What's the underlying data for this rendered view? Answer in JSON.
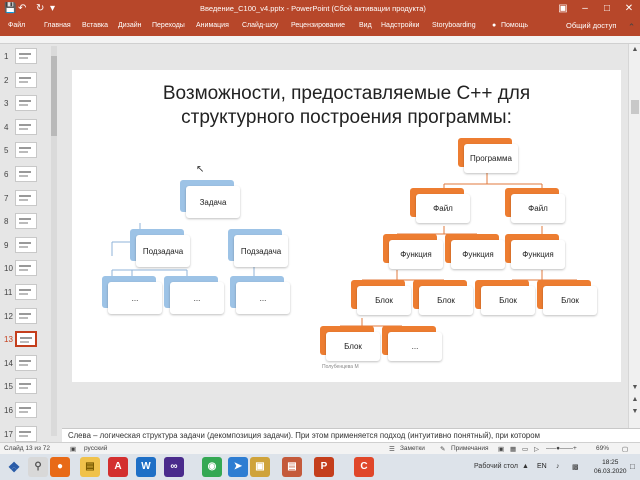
{
  "window": {
    "doc_title": "Введение_С100_v4.pptx - PowerPoint (Сбой активации продукта)",
    "save_icon": "save-icon",
    "undo_icon": "undo-icon",
    "redo_icon": "redo-icon",
    "minimize_icon": "minimize-icon",
    "restore_icon": "restore-icon",
    "close_icon": "close-icon"
  },
  "ribbon": {
    "tabs": [
      "Файл",
      "Главная",
      "Вставка",
      "Дизайн",
      "Переходы",
      "Анимация",
      "Слайд-шоу",
      "Рецензирование",
      "Вид",
      "Надстройки",
      "Storyboarding"
    ],
    "help": "Помощь",
    "share": "Общий доступ"
  },
  "thumbnails": [
    {
      "num": "1"
    },
    {
      "num": "2"
    },
    {
      "num": "3"
    },
    {
      "num": "4"
    },
    {
      "num": "5"
    },
    {
      "num": "6"
    },
    {
      "num": "7"
    },
    {
      "num": "8"
    },
    {
      "num": "9"
    },
    {
      "num": "10"
    },
    {
      "num": "11"
    },
    {
      "num": "12"
    },
    {
      "num": "13",
      "active": true
    },
    {
      "num": "14"
    },
    {
      "num": "15"
    },
    {
      "num": "16"
    },
    {
      "num": "17"
    }
  ],
  "slide": {
    "title_line1": "Возможности, предоставляемые С++ для",
    "title_line2": "структурного построения программы:",
    "author": "Полубенцева М",
    "left_tree": {
      "root": "Задача",
      "level2": [
        "Подзадача",
        "Подзадача"
      ],
      "level3": [
        "...",
        "...",
        "..."
      ]
    },
    "right_tree": {
      "root": "Программа",
      "files": [
        "Файл",
        "Файл"
      ],
      "functions": [
        "Функция",
        "Функция",
        "Функция"
      ],
      "blocks": [
        "Блок",
        "Блок",
        "Блок",
        "Блок"
      ],
      "bottom": [
        "Блок",
        "..."
      ]
    },
    "colors": {
      "blue_back": "#9dc3e6",
      "orange_back": "#ed7d31"
    }
  },
  "notes": {
    "text": "Слева – логическая структура задачи (декомпозиция задачи). При этом применяется подход (интуитивно понятный), при котором"
  },
  "statusbar": {
    "slide_info": "Слайд 13 из 72",
    "language": "русский",
    "notes_label": "Заметки",
    "comments_label": "Примечания",
    "zoom": "69%"
  },
  "taskbar": {
    "desktop": "Рабочий стол",
    "lang": "EN",
    "time": "18:25",
    "date": "06.03.2020"
  }
}
